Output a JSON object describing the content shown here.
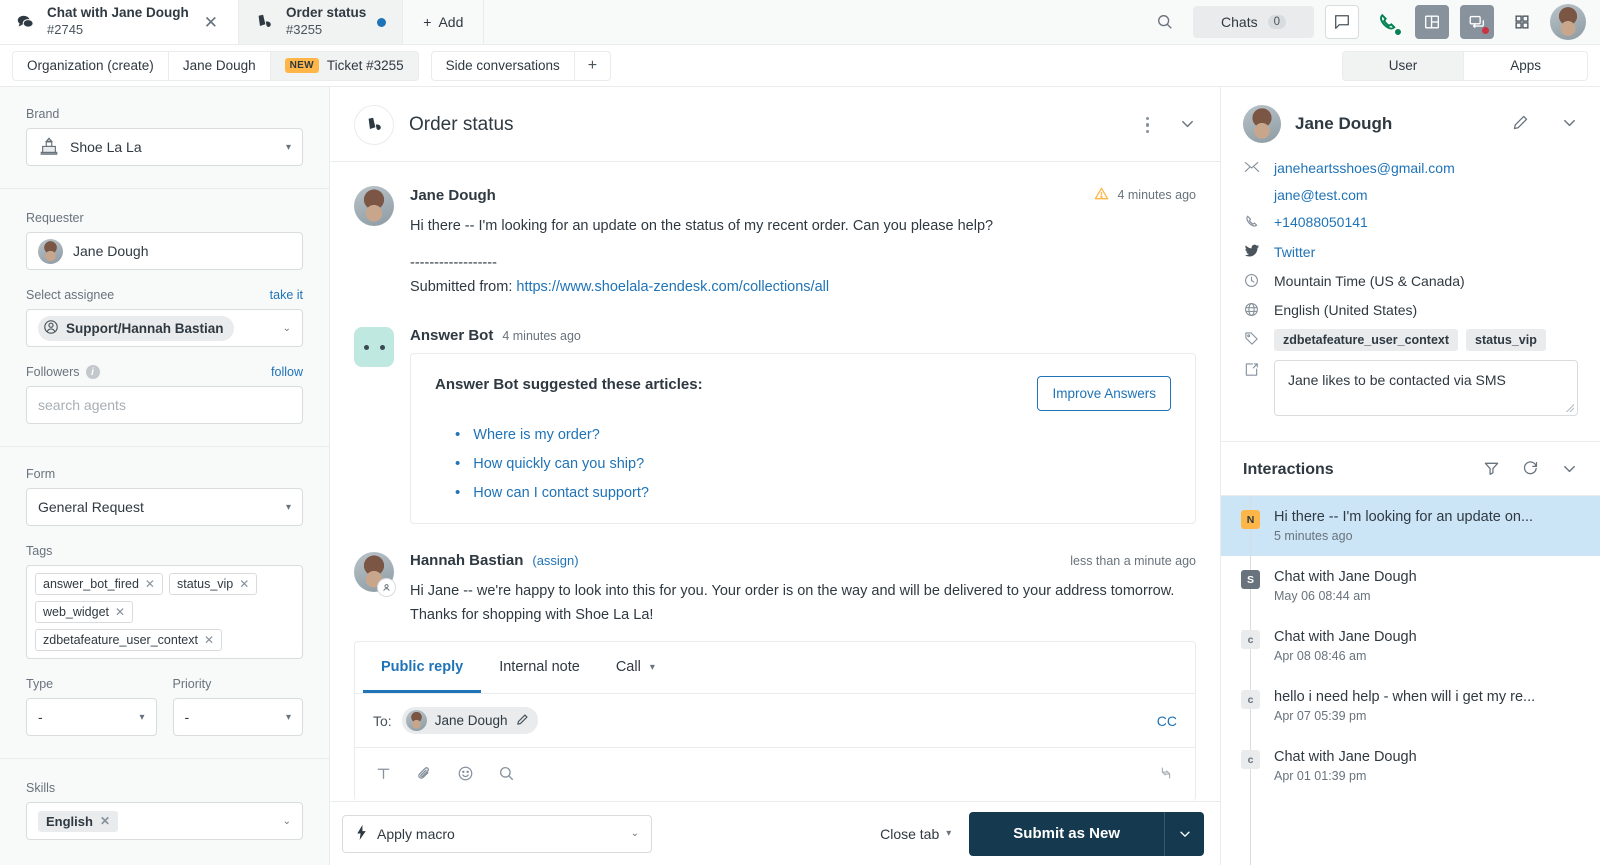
{
  "tabs": [
    {
      "icon": "chat-bubbles-icon",
      "title": "Chat with Jane Dough",
      "sub": "#2745",
      "state": "active",
      "trailing": "close"
    },
    {
      "icon": "shoe-icon",
      "title": "Order status",
      "sub": "#3255",
      "state": "inactive",
      "trailing": "dot"
    }
  ],
  "add_tab_label": "Add",
  "toolbar": {
    "search_icon": "search-icon",
    "chats_label": "Chats",
    "chats_count": "0",
    "message_icon": "message-square-icon",
    "phone_icon": "phone-icon",
    "panel_icon": "layout-panel-icon",
    "talk_icon": "talk-routing-icon",
    "grid_icon": "apps-grid-icon",
    "avatar": "user-avatar"
  },
  "nav": {
    "tabs": [
      {
        "label": "Organization (create)",
        "selected": false,
        "badge": ""
      },
      {
        "label": "Jane Dough",
        "selected": false,
        "badge": ""
      },
      {
        "label": "Ticket #3255",
        "selected": true,
        "badge": "NEW"
      },
      {
        "label": "Side conversations",
        "selected": false,
        "badge": ""
      }
    ],
    "add_label": "+",
    "segments": [
      {
        "label": "User",
        "on": true
      },
      {
        "label": "Apps",
        "on": false
      }
    ]
  },
  "sidebar": {
    "brand": {
      "label": "Brand",
      "value": "Shoe La La",
      "icon": "building-icon"
    },
    "requester": {
      "label": "Requester",
      "value": "Jane Dough"
    },
    "assignee": {
      "label": "Select assignee",
      "action": "take it",
      "value": "Support/Hannah Bastian"
    },
    "followers": {
      "label": "Followers",
      "action": "follow",
      "placeholder": "search agents"
    },
    "form": {
      "label": "Form",
      "value": "General Request"
    },
    "tags": {
      "label": "Tags",
      "items": [
        "answer_bot_fired",
        "status_vip",
        "web_widget",
        "zdbetafeature_user_context"
      ]
    },
    "type": {
      "label": "Type",
      "value": "-"
    },
    "priority": {
      "label": "Priority",
      "value": "-"
    },
    "skills": {
      "label": "Skills",
      "value": "English"
    }
  },
  "conversation": {
    "icon": "shoe-icon",
    "title": "Order status",
    "messages": [
      {
        "author": "Jane Dough",
        "time": "4 minutes ago",
        "warning": true,
        "avatar": "jane-avatar",
        "text": "Hi there -- I'm looking for an update on the status of my recent order. Can you please help?",
        "separator": "------------------",
        "submitted_prefix": "Submitted from: ",
        "submitted_link": "https://www.shoelala-zendesk.com/collections/all"
      },
      {
        "author": "Answer Bot",
        "time": "4 minutes ago",
        "avatar": "answer-bot-avatar",
        "card": {
          "title": "Answer Bot suggested these articles:",
          "button": "Improve Answers",
          "articles": [
            "Where is my order?",
            "How quickly can you ship?",
            "How can I contact support?"
          ]
        }
      },
      {
        "author": "Hannah Bastian",
        "assign": "(assign)",
        "time": "less than a minute ago",
        "avatar": "hannah-avatar",
        "text": "Hi Jane -- we're happy to look into this for you. Your order is on the way and will be delivered to your address tomorrow. Thanks for shopping with Shoe La La!"
      }
    ]
  },
  "composer": {
    "tabs": [
      {
        "label": "Public reply",
        "on": true,
        "caret": false
      },
      {
        "label": "Internal note",
        "on": false,
        "caret": false
      },
      {
        "label": "Call",
        "on": false,
        "caret": true
      }
    ],
    "to_label": "To:",
    "to_value": "Jane Dough",
    "cc_label": "CC",
    "tools": [
      "text-format-icon",
      "attachment-icon",
      "emoji-icon",
      "knowledge-search-icon",
      "resize-handle-icon"
    ]
  },
  "footer": {
    "macro_label": "Apply macro",
    "close_tab_label": "Close tab",
    "submit_label": "Submit as New"
  },
  "user_panel": {
    "name": "Jane Dough",
    "edit_icon": "pencil-icon",
    "collapse_icon": "chevron-down-icon",
    "email_primary": "janeheartsshoes@gmail.com",
    "email_secondary": "jane@test.com",
    "phone": "+14088050141",
    "twitter": "Twitter",
    "timezone": "Mountain Time (US & Canada)",
    "language": "English (United States)",
    "tags": [
      "zdbetafeature_user_context",
      "status_vip"
    ],
    "note": "Jane likes to be contacted via SMS"
  },
  "interactions": {
    "title": "Interactions",
    "filter_icon": "filter-icon",
    "refresh_icon": "refresh-icon",
    "collapse_icon": "chevron-down-icon",
    "events": [
      {
        "badge": "N",
        "badge_color": "#ffb648",
        "badge_text_color": "#2f3941",
        "title": "Hi there -- I'm looking for an update on...",
        "date": "5 minutes ago",
        "highlight": true
      },
      {
        "badge": "S",
        "badge_color": "#68737d",
        "badge_text_color": "#ffffff",
        "title": "Chat with Jane Dough",
        "date": "May 06 08:44 am",
        "highlight": false
      },
      {
        "badge": "c",
        "badge_color": "#e9ebed",
        "badge_text_color": "#68737d",
        "title": "Chat with Jane Dough",
        "date": "Apr 08 08:46 am",
        "highlight": false
      },
      {
        "badge": "c",
        "badge_color": "#e9ebed",
        "badge_text_color": "#68737d",
        "title": "hello i need help - when will i get my re...",
        "date": "Apr 07 05:39 pm",
        "highlight": false
      },
      {
        "badge": "c",
        "badge_color": "#e9ebed",
        "badge_text_color": "#68737d",
        "title": "Chat with Jane Dough",
        "date": "Apr 01 01:39 pm",
        "highlight": false
      }
    ]
  },
  "colors": {
    "accent_blue": "#1f73b7",
    "highlight_blue": "#cce5f6",
    "submit_navy": "#15394f",
    "badge_orange": "#ffb648",
    "bot_mint": "#bfe8e0",
    "border": "#e9ebed"
  }
}
